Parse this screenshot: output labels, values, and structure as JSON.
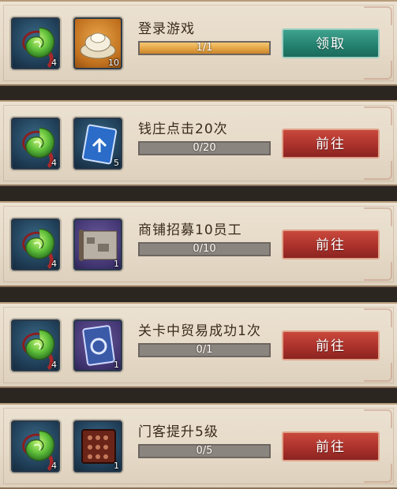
{
  "tasks": [
    {
      "title": "登录游戏",
      "reward_count": "4",
      "item_count": "10",
      "item_icon": "silver-ingot-icon",
      "item_slot": "gold",
      "progress_text": "1/1",
      "progress_fraction": 1.0,
      "button_label": "领取",
      "button_style": "green"
    },
    {
      "title": "钱庄点击20次",
      "reward_count": "4",
      "item_count": "5",
      "item_icon": "blue-card-icon",
      "item_slot": "blue",
      "progress_text": "0/20",
      "progress_fraction": 0,
      "button_label": "前往",
      "button_style": "red"
    },
    {
      "title": "商铺招募10员工",
      "reward_count": "4",
      "item_count": "1",
      "item_icon": "map-scroll-icon",
      "item_slot": "purple",
      "progress_text": "0/10",
      "progress_fraction": 0,
      "button_label": "前往",
      "button_style": "red"
    },
    {
      "title": "关卡中贸易成功1次",
      "reward_count": "4",
      "item_count": "1",
      "item_icon": "trade-card-icon",
      "item_slot": "purple",
      "progress_text": "0/1",
      "progress_fraction": 0,
      "button_label": "前往",
      "button_style": "red"
    },
    {
      "title": "门客提升5级",
      "reward_count": "4",
      "item_count": "1",
      "item_icon": "abacus-icon",
      "item_slot": "blue",
      "progress_text": "0/5",
      "progress_fraction": 0,
      "button_label": "前往",
      "button_style": "red"
    }
  ],
  "colors": {
    "green_button": "#23806e",
    "red_button": "#a8302a",
    "progress_fill": "#e3a444"
  }
}
